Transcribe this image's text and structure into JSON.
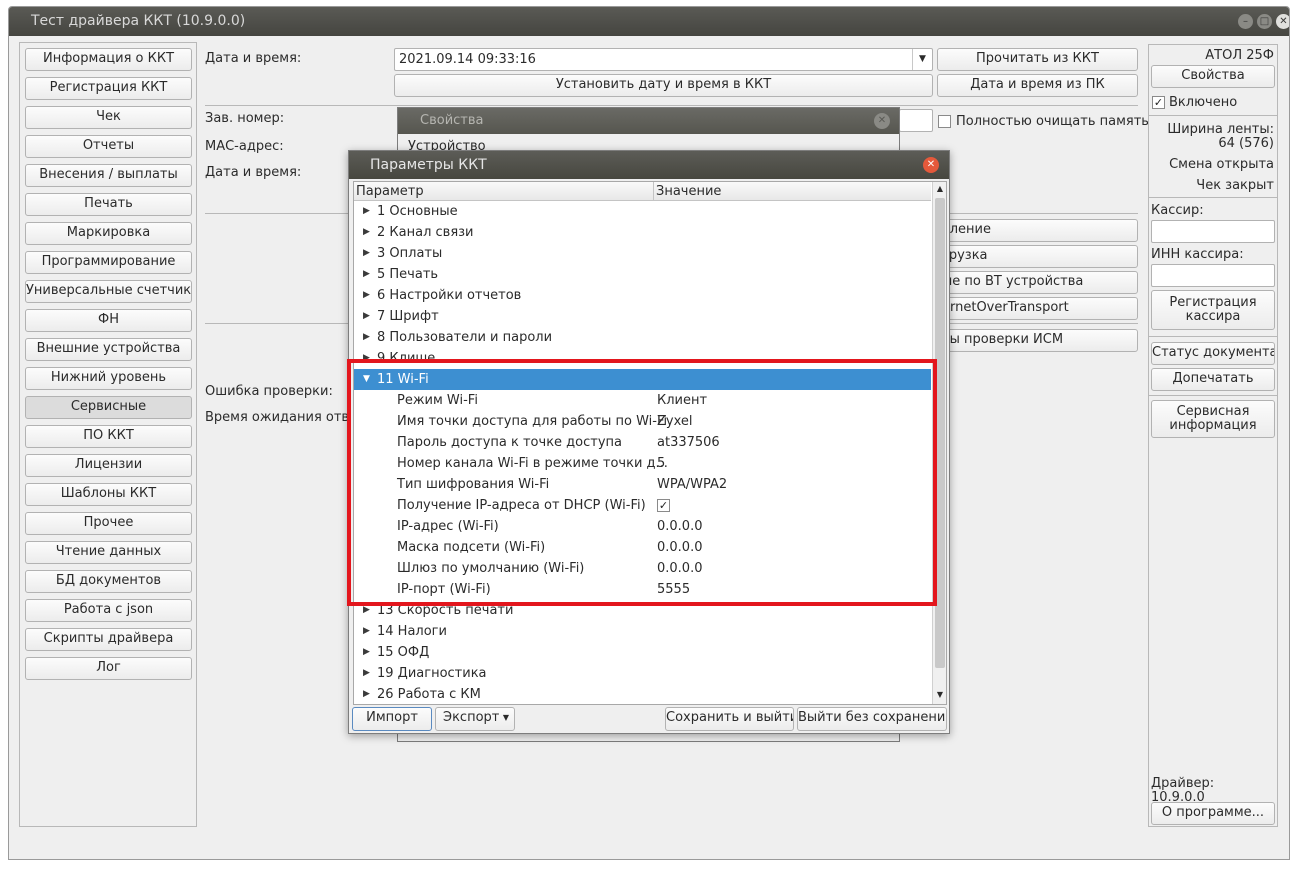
{
  "window": {
    "title": "Тест драйвера ККТ (10.9.0.0)"
  },
  "left_menu": [
    "Информация о ККТ",
    "Регистрация ККТ",
    "Чек",
    "Отчеты",
    "Внесения / выплаты",
    "Печать",
    "Маркировка",
    "Программирование",
    "Универсальные счетчики",
    "ФН",
    "Внешние устройства",
    "Нижний уровень",
    "Сервисные",
    "ПО ККТ",
    "Лицензии",
    "Шаблоны ККТ",
    "Прочее",
    "Чтение данных",
    "БД документов",
    "Работа с json",
    "Скрипты драйвера",
    "Лог"
  ],
  "main": {
    "datetime_label": "Дата и время:",
    "datetime_value": "2021.09.14 09:33:16",
    "read_button": "Прочитать из ККТ",
    "set_button": "Установить дату и время в ККТ",
    "from_pc_button": "Дата и время из ПК",
    "serial_label": "Зав. номер:",
    "mac_label": "МАС-адрес:",
    "datetime2_label": "Дата и время:",
    "clear_memory_label": "Полностью очищать память",
    "btn_rounding": "уление",
    "btn_upload": "грузка",
    "btn_bt": "ые по BT устройства",
    "btn_ethernet": "ernetOverTransport",
    "btn_ism": "ты проверки ИСМ",
    "check_error_label": "Ошибка проверки:",
    "wait_label": "Время ожидания ответ"
  },
  "right_panel": {
    "model": "АТОЛ 25Ф",
    "properties_button": "Свойства",
    "enabled_label": "Включено",
    "enabled": true,
    "tape_width_label": "Ширина ленты:",
    "tape_width_value": "64 (576)",
    "shift_status": "Смена открыта",
    "receipt_status": "Чек закрыт",
    "cashier_label": "Кассир:",
    "cashier_inn_label": "ИНН кассира:",
    "register_cashier_button_line1": "Регистрация",
    "register_cashier_button_line2": "кассира",
    "doc_status_button": "Статус документа",
    "reprint_button": "Допечатать",
    "service_info_line1": "Сервисная",
    "service_info_line2": "информация",
    "driver_label": "Драйвер:",
    "driver_version": "10.9.0.0",
    "about_button": "О программе..."
  },
  "properties_dialog": {
    "title": "Свойства",
    "tab_label": "Устройство"
  },
  "params_dialog": {
    "title": "Параметры ККТ",
    "col_param": "Параметр",
    "col_value": "Значение",
    "top_groups": [
      "1 Основные",
      "2 Канал связи",
      "3 Оплаты",
      "5 Печать",
      "6 Настройки отчетов",
      "7 Шрифт",
      "8 Пользователи и пароли",
      "9 Клише"
    ],
    "selected_group": "11 Wi-Fi",
    "wifi_params": [
      {
        "name": "Режим Wi-Fi",
        "value": "Клиент"
      },
      {
        "name": "Имя точки доступа для работы по Wi-Fi",
        "value": "Zyxel"
      },
      {
        "name": "Пароль доступа к точке доступа",
        "value": "at337506"
      },
      {
        "name": "Номер канала Wi-Fi в режиме точки д...",
        "value": "5"
      },
      {
        "name": "Тип шифрования Wi-Fi",
        "value": "WPA/WPA2"
      },
      {
        "name": "Получение IP-адреса от DHCP (Wi-Fi)",
        "value": "✓"
      },
      {
        "name": "IP-адрес (Wi-Fi)",
        "value": "0.0.0.0"
      },
      {
        "name": "Маска подсети (Wi-Fi)",
        "value": "0.0.0.0"
      },
      {
        "name": "Шлюз по умолчанию (Wi-Fi)",
        "value": "0.0.0.0"
      },
      {
        "name": "IP-порт (Wi-Fi)",
        "value": "5555"
      }
    ],
    "bottom_groups": [
      "13 Скорость печати",
      "14 Налоги",
      "15 ОФД",
      "19 Диагностика",
      "26 Работа с КМ"
    ],
    "import_button": "Импорт",
    "export_button": "Экспорт",
    "save_exit_button": "Сохранить и выйти",
    "exit_no_save_button": "Выйти без сохранения"
  },
  "colors": {
    "selection": "#3d8fd1",
    "highlight_border": "#e3161d",
    "close_button": "#e4593b"
  }
}
